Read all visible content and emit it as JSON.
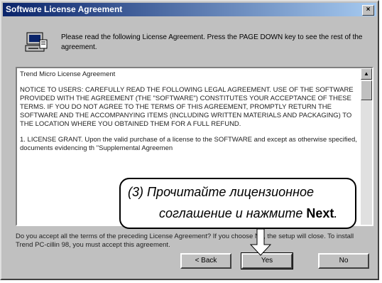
{
  "window": {
    "title": "Software License Agreement",
    "close_label": "×"
  },
  "intro": {
    "text": "Please read the following License Agreement. Press the PAGE DOWN key to see the rest of the agreement."
  },
  "license": {
    "heading": "Trend Micro License Agreement",
    "notice": "NOTICE TO USERS: CAREFULLY READ THE FOLLOWING LEGAL AGREEMENT. USE OF THE SOFTWARE PROVIDED WITH THE AGREEMENT (THE \"SOFTWARE\") CONSTITUTES YOUR ACCEPTANCE OF THESE TERMS. IF YOU DO NOT AGREE TO THE TERMS OF THIS AGREEMENT, PROMPTLY RETURN THE SOFTWARE AND THE ACCOMPANYING ITEMS (INCLUDING WRITTEN MATERIALS AND PACKAGING) TO THE LOCATION WHERE YOU OBTAINED THEM FOR A FULL REFUND.",
    "grant": "1. LICENSE GRANT. Upon the valid purchase of a license to the SOFTWARE and except as otherwise specified, documents evidencing th \"Supplemental Agreemen"
  },
  "question": {
    "text": "Do you accept all the terms of the preceding License Agreement? If you choose No, the setup will close. To install Trend PC-cillin 98, you must accept this agreement."
  },
  "buttons": {
    "back": "< Back",
    "yes": "Yes",
    "no": "No"
  },
  "callout": {
    "step": "(3)",
    "line1": "Прочитайте лицензионное",
    "line2_prefix": "соглашение и нажмите ",
    "line2_bold": "Next",
    "line2_suffix": "."
  }
}
